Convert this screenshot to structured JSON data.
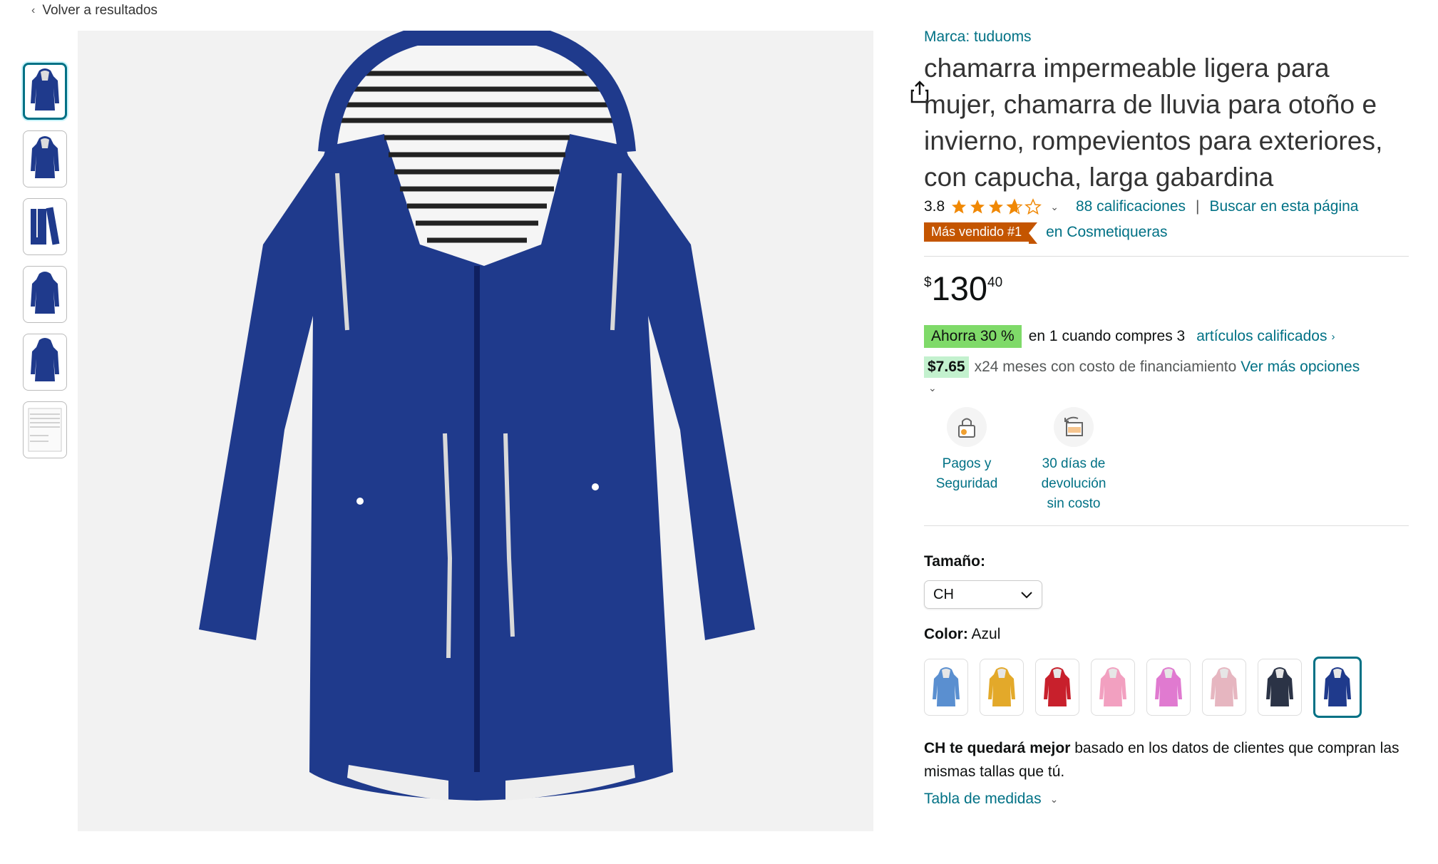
{
  "nav": {
    "back_label": "Volver a resultados"
  },
  "product": {
    "brand": "Marca: tuduoms",
    "title": "chamarra impermeable ligera para mujer, chamarra de lluvia para otoño e invierno, rompevientos para exteriores, con capucha, larga gabardina",
    "rating": "3.8",
    "rating_value": 3.8,
    "ratings_count": "88 calificaciones",
    "search_page_link": "Buscar en esta página",
    "bestseller_badge": "Más vendido #1",
    "bestseller_category": "en Cosmetiqueras",
    "price": {
      "symbol": "$",
      "whole": "130",
      "fraction": "40"
    },
    "promo": {
      "badge": "Ahorra 30 %",
      "text": "en 1 cuando compres 3",
      "link": "artículos calificados"
    },
    "financing": {
      "amount": "$7.65",
      "text": "x24 meses con costo de financiamiento",
      "link": "Ver más opciones"
    },
    "features": [
      {
        "icon": "lock-payment-icon",
        "label": "Pagos y Seguridad"
      },
      {
        "icon": "return-box-icon",
        "label": "30 días de devolución sin costo"
      }
    ],
    "size": {
      "label": "Tamaño:",
      "selected": "CH"
    },
    "color": {
      "label": "Color:",
      "selected": "Azul"
    },
    "swatches": [
      {
        "name": "light-blue",
        "color": "#5a8fd0"
      },
      {
        "name": "yellow",
        "color": "#e3a92a"
      },
      {
        "name": "red",
        "color": "#c8202c"
      },
      {
        "name": "pink",
        "color": "#f2a0c0"
      },
      {
        "name": "magenta",
        "color": "#e07ad0"
      },
      {
        "name": "light-pink",
        "color": "#e6b6c0"
      },
      {
        "name": "dark-navy",
        "color": "#2b3346"
      },
      {
        "name": "navy",
        "color": "#1f3a8c",
        "selected": true
      }
    ],
    "fit": {
      "bold": "CH te quedará mejor",
      "rest": " basado en los datos de clientes que compran las mismas tallas que tú."
    },
    "size_chart_link": "Tabla de medidas"
  },
  "colors": {
    "link": "#007185",
    "badge": "#c45500",
    "promo": "#7fda69",
    "jacket": "#1f3a8c"
  },
  "gallery": {
    "thumbnail_count": 6
  }
}
